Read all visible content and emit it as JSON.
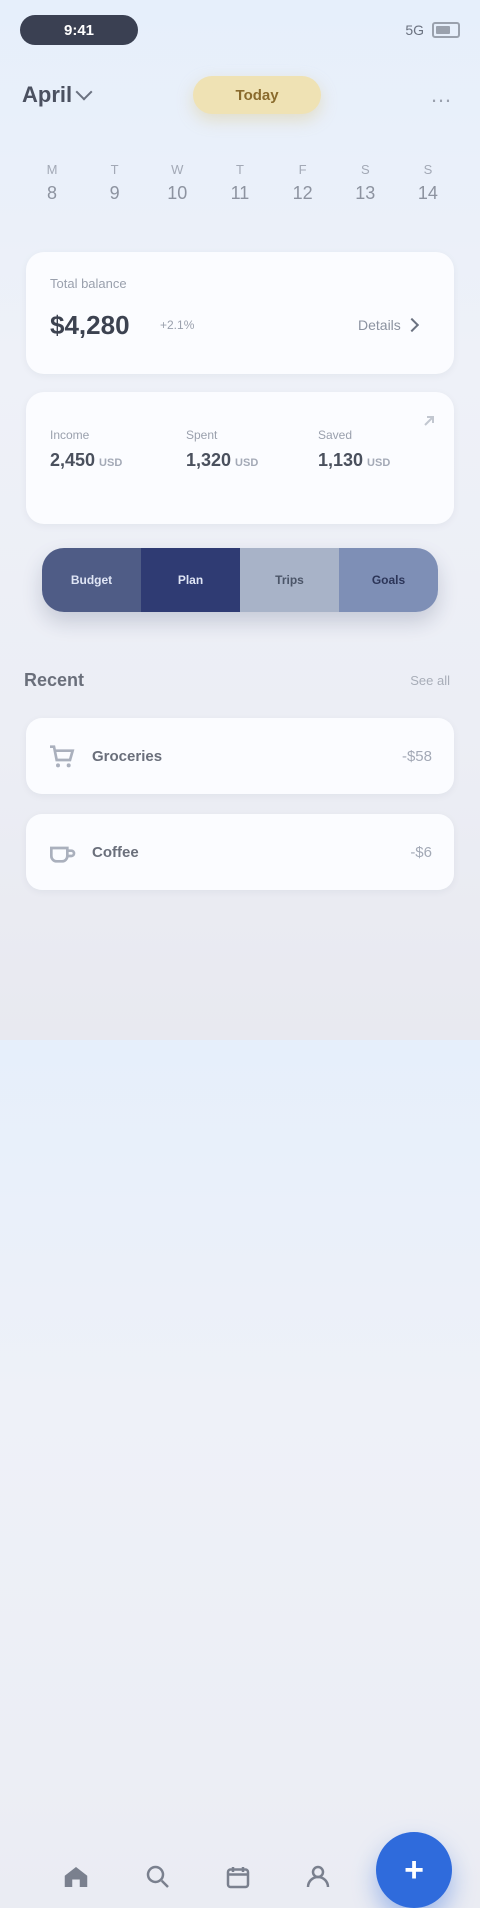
{
  "status": {
    "time": "9:41",
    "signal": "5G"
  },
  "header": {
    "month": "April",
    "today": "Today",
    "more": "…"
  },
  "week": [
    {
      "label": "M",
      "date": "8"
    },
    {
      "label": "T",
      "date": "9"
    },
    {
      "label": "W",
      "date": "10"
    },
    {
      "label": "T",
      "date": "11"
    },
    {
      "label": "F",
      "date": "12"
    },
    {
      "label": "S",
      "date": "13"
    },
    {
      "label": "S",
      "date": "14"
    }
  ],
  "balance": {
    "label": "Total balance",
    "amount": "$4,280",
    "trend": "+2.1%",
    "details": "Details"
  },
  "stats": [
    {
      "label": "Income",
      "value": "2,450",
      "unit": "USD"
    },
    {
      "label": "Spent",
      "value": "1,320",
      "unit": "USD"
    },
    {
      "label": "Saved",
      "value": "1,130",
      "unit": "USD"
    }
  ],
  "banner": [
    "Budget",
    "Plan",
    "Trips",
    "Goals"
  ],
  "section": {
    "title": "Recent",
    "see_all": "See all"
  },
  "transactions": [
    {
      "name": "Groceries",
      "amount": "-$58"
    },
    {
      "name": "Coffee",
      "amount": "-$6"
    }
  ],
  "nav": {
    "add": "+"
  },
  "colors": {
    "accent": "#2f6bdc",
    "today_pill": "#efe2b4"
  }
}
